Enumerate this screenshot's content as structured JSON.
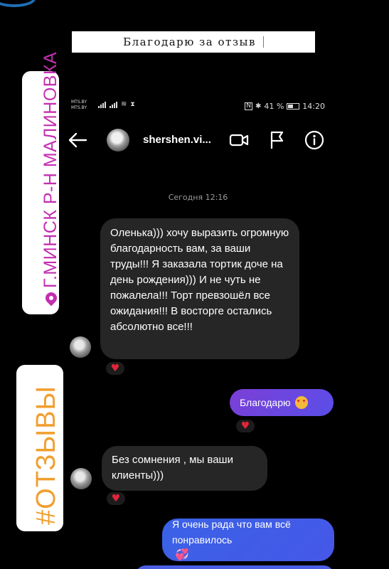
{
  "banner": {
    "title": "Благодарю за отзыв"
  },
  "stickers": {
    "location": "Г.МИНСК Р-Н МАЛИНОВКА",
    "hashtag": "#ОТЗЫВЫ"
  },
  "status_bar": {
    "carrier_1": "MTS.BY",
    "carrier_2": "MTS.BY",
    "battery": "41 %",
    "time": "14:20"
  },
  "chat": {
    "username": "shershen.vi...",
    "date": "Сегодня 12:16"
  },
  "messages": [
    {
      "from": "contact",
      "text": "Оленька))) хочу выразить огромную благодарность вам, за ваши труды!!! Я заказала тортик доче на день рождения))) И не чуть не пожалела!!! Торт превзошёл все ожидания!!! В восторге остались абсолютно все!!!",
      "reaction": "♥"
    },
    {
      "from": "me",
      "text": "Благодарю",
      "reaction": "♥"
    },
    {
      "from": "contact",
      "text": "Без сомнения , мы ваши клиенты)))",
      "reaction": "♥"
    },
    {
      "from": "me",
      "text": "Я очень рада что вам всё понравилось"
    }
  ],
  "colors": {
    "location_text": "#c42fb0",
    "hashtag_text": "#f19e2e",
    "outgoing_bubble": "#6a47e0",
    "incoming_bubble": "#262626",
    "reaction_heart": "#e0253b"
  }
}
